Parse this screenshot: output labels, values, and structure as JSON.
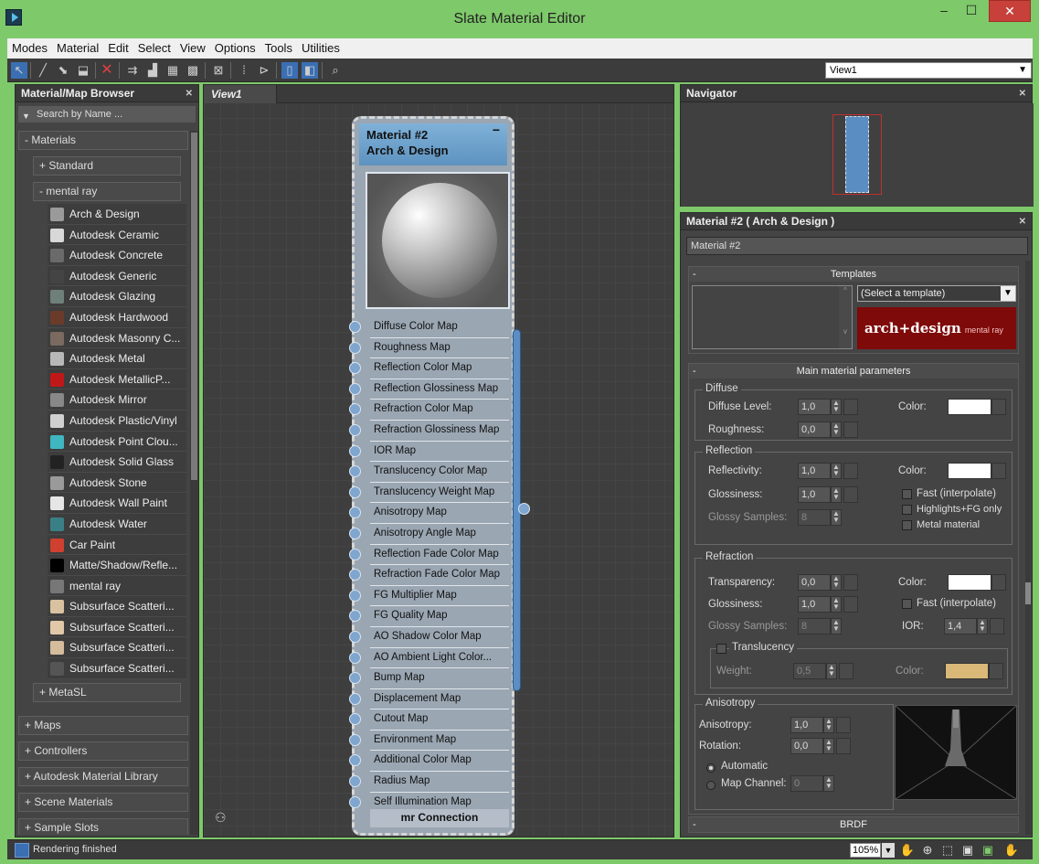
{
  "window": {
    "title": "Slate Material Editor",
    "minimize": "–",
    "maximize": "☐",
    "close": "✕"
  },
  "menu": [
    "Modes",
    "Material",
    "Edit",
    "Select",
    "View",
    "Options",
    "Tools",
    "Utilities"
  ],
  "toolbar": {
    "view_select": "View1"
  },
  "browser": {
    "title": "Material/Map Browser",
    "search_placeholder": "Search by Name ...",
    "groups": {
      "materials": "- Materials",
      "standard": "+ Standard",
      "mental_ray": "- mental ray",
      "metasl": "+ MetaSL",
      "maps": "+ Maps",
      "controllers": "+ Controllers",
      "autodesk_lib": "+ Autodesk Material Library",
      "scene_materials": "+ Scene Materials",
      "sample_slots": "+ Sample Slots"
    },
    "items": [
      {
        "label": "Arch & Design",
        "color": "#9a9a9a"
      },
      {
        "label": "Autodesk Ceramic",
        "color": "#d8d8d8"
      },
      {
        "label": "Autodesk Concrete",
        "color": "#6a6a6a"
      },
      {
        "label": "Autodesk Generic",
        "color": "#444444"
      },
      {
        "label": "Autodesk Glazing",
        "color": "#6f7f7a"
      },
      {
        "label": "Autodesk Hardwood",
        "color": "#6b3b2a"
      },
      {
        "label": "Autodesk Masonry C...",
        "color": "#7a6a60"
      },
      {
        "label": "Autodesk Metal",
        "color": "#b8b8b8"
      },
      {
        "label": "Autodesk MetallicP...",
        "color": "#c01818"
      },
      {
        "label": "Autodesk Mirror",
        "color": "#888888"
      },
      {
        "label": "Autodesk Plastic/Vinyl",
        "color": "#d0d0d0"
      },
      {
        "label": "Autodesk Point Clou...",
        "color": "#3fb6c0"
      },
      {
        "label": "Autodesk Solid Glass",
        "color": "#222222"
      },
      {
        "label": "Autodesk Stone",
        "color": "#9a9a9a"
      },
      {
        "label": "Autodesk Wall Paint",
        "color": "#e6e6e6"
      },
      {
        "label": "Autodesk Water",
        "color": "#3a7f86"
      },
      {
        "label": "Car Paint",
        "color": "#d04030"
      },
      {
        "label": "Matte/Shadow/Refle...",
        "color": "#000000"
      },
      {
        "label": "mental ray",
        "color": "#777777"
      },
      {
        "label": "Subsurface Scatteri...",
        "color": "#d9c2a0"
      },
      {
        "label": "Subsurface Scatteri...",
        "color": "#e0c8a8"
      },
      {
        "label": "Subsurface Scatteri...",
        "color": "#d4bc9c"
      },
      {
        "label": "Subsurface Scatteri...",
        "color": "#555555"
      }
    ]
  },
  "view": {
    "tab": "View1",
    "node": {
      "name": "Material #2",
      "type": "Arch & Design",
      "slots": [
        "Diffuse Color Map",
        "Roughness Map",
        "Reflection Color Map",
        "Reflection Glossiness Map",
        "Refraction Color Map",
        "Refraction Glossiness Map",
        "IOR Map",
        "Translucency Color Map",
        "Translucency Weight Map",
        "Anisotropy Map",
        "Anisotropy Angle Map",
        "Reflection Fade Color Map",
        "Refraction Fade Color Map",
        "FG Multiplier Map",
        "FG Quality Map",
        "AO Shadow Color Map",
        "AO Ambient Light Color...",
        "Bump Map",
        "Displacement Map",
        "Cutout Map",
        "Environment Map",
        "Additional Color Map",
        "Radius Map",
        "Self Illumination Map"
      ],
      "footer": "mr Connection"
    }
  },
  "navigator": {
    "title": "Navigator"
  },
  "params": {
    "title": "Material #2  ( Arch & Design )",
    "name": "Material #2",
    "templates": {
      "label": "Templates",
      "select": "(Select a template)",
      "logo": "arch+design",
      "logo_sub": "mental ray"
    },
    "main": {
      "label": "Main material parameters",
      "diffuse": {
        "group": "Diffuse",
        "level_label": "Diffuse Level:",
        "level": "1,0",
        "rough_label": "Roughness:",
        "rough": "0,0",
        "color_label": "Color:",
        "color": "#ffffff"
      },
      "reflection": {
        "group": "Reflection",
        "refl_label": "Reflectivity:",
        "refl": "1,0",
        "gloss_label": "Glossiness:",
        "gloss": "1,0",
        "samples_label": "Glossy Samples:",
        "samples": "8",
        "color_label": "Color:",
        "color": "#ffffff",
        "fast": "Fast (interpolate)",
        "highlights": "Highlights+FG only",
        "metal": "Metal material"
      },
      "refraction": {
        "group": "Refraction",
        "trans_label": "Transparency:",
        "trans": "0,0",
        "gloss_label": "Glossiness:",
        "gloss": "1,0",
        "samples_label": "Glossy Samples:",
        "samples": "8",
        "color_label": "Color:",
        "color": "#ffffff",
        "fast": "Fast (interpolate)",
        "ior_label": "IOR:",
        "ior": "1,4"
      },
      "translucency": {
        "group": "Translucency",
        "weight_label": "Weight:",
        "weight": "0,5",
        "color_label": "Color:",
        "color": "#d9b878"
      },
      "anisotropy": {
        "group": "Anisotropy",
        "aniso_label": "Anisotropy:",
        "aniso": "1,0",
        "rot_label": "Rotation:",
        "rot": "0,0",
        "auto": "Automatic",
        "channel_label": "Map Channel:",
        "channel": "0"
      }
    },
    "brdf": "BRDF"
  },
  "status": {
    "text": "Rendering finished",
    "zoom": "105%"
  }
}
